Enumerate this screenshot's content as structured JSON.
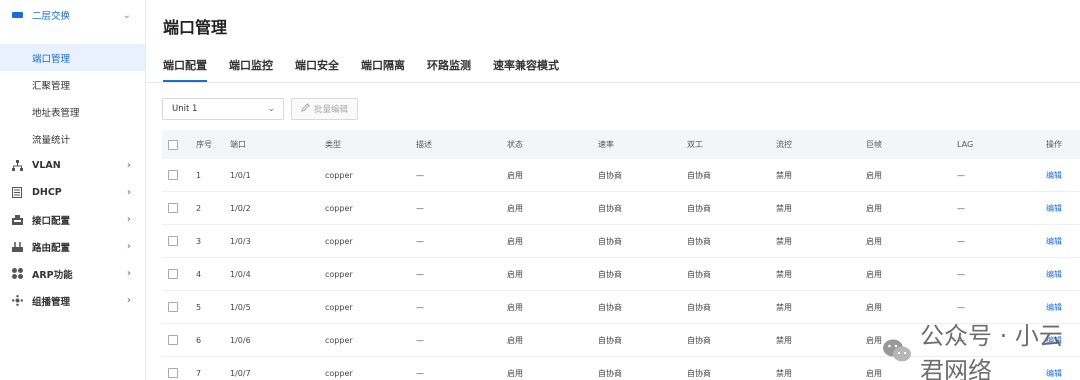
{
  "sidebar": {
    "group": {
      "label": "二层交换",
      "icon": "switch-icon"
    },
    "subitems": [
      "端口管理",
      "汇聚管理",
      "地址表管理",
      "流量统计"
    ],
    "items": [
      {
        "label": "VLAN",
        "icon": "vlan-icon"
      },
      {
        "label": "DHCP",
        "icon": "dhcp-icon"
      },
      {
        "label": "接口配置",
        "icon": "interface-icon"
      },
      {
        "label": "路由配置",
        "icon": "router-icon"
      },
      {
        "label": "ARP功能",
        "icon": "arp-icon"
      },
      {
        "label": "组播管理",
        "icon": "multicast-icon"
      }
    ]
  },
  "main": {
    "title": "端口管理",
    "tabs": [
      "端口配置",
      "端口监控",
      "端口安全",
      "端口隔离",
      "环路监测",
      "速率兼容模式"
    ],
    "unit_select": "Unit 1",
    "batch_edit": "批量编辑"
  },
  "table": {
    "columns": [
      "序号",
      "端口",
      "类型",
      "描述",
      "状态",
      "速率",
      "双工",
      "流控",
      "巨帧",
      "LAG",
      "操作"
    ],
    "rows": [
      {
        "no": "1",
        "port": "1/0/1",
        "type": "copper",
        "desc": "—",
        "state": "启用",
        "rate": "自协商",
        "duplex": "自协商",
        "flow": "禁用",
        "jumbo": "启用",
        "lag": "—",
        "op": "编辑"
      },
      {
        "no": "2",
        "port": "1/0/2",
        "type": "copper",
        "desc": "—",
        "state": "启用",
        "rate": "自协商",
        "duplex": "自协商",
        "flow": "禁用",
        "jumbo": "启用",
        "lag": "—",
        "op": "编辑"
      },
      {
        "no": "3",
        "port": "1/0/3",
        "type": "copper",
        "desc": "—",
        "state": "启用",
        "rate": "自协商",
        "duplex": "自协商",
        "flow": "禁用",
        "jumbo": "启用",
        "lag": "—",
        "op": "编辑"
      },
      {
        "no": "4",
        "port": "1/0/4",
        "type": "copper",
        "desc": "—",
        "state": "启用",
        "rate": "自协商",
        "duplex": "自协商",
        "flow": "禁用",
        "jumbo": "启用",
        "lag": "—",
        "op": "编辑"
      },
      {
        "no": "5",
        "port": "1/0/5",
        "type": "copper",
        "desc": "—",
        "state": "启用",
        "rate": "自协商",
        "duplex": "自协商",
        "flow": "禁用",
        "jumbo": "启用",
        "lag": "—",
        "op": "编辑"
      },
      {
        "no": "6",
        "port": "1/0/6",
        "type": "copper",
        "desc": "—",
        "state": "启用",
        "rate": "自协商",
        "duplex": "自协商",
        "flow": "禁用",
        "jumbo": "启用",
        "lag": "—",
        "op": "编辑"
      },
      {
        "no": "7",
        "port": "1/0/7",
        "type": "copper",
        "desc": "—",
        "state": "启用",
        "rate": "自协商",
        "duplex": "自协商",
        "flow": "禁用",
        "jumbo": "启用",
        "lag": "—",
        "op": "编辑"
      }
    ]
  },
  "watermark": {
    "text": "公众号 · 小云君网络",
    "icon": "wechat-icon"
  },
  "colors": {
    "accent": "#1a6ed8",
    "active_bg": "#e8f1fd",
    "header_bg": "#f4f5f7"
  }
}
